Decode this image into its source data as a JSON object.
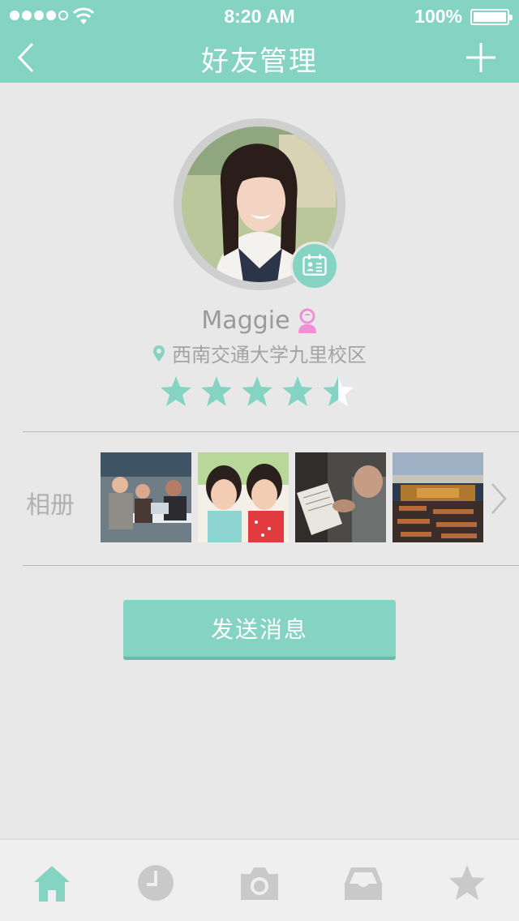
{
  "status_bar": {
    "time": "8:20 AM",
    "battery": "100%"
  },
  "nav": {
    "title": "好友管理"
  },
  "profile": {
    "name": "Maggie",
    "location": "西南交通大学九里校区",
    "rating": 4.5
  },
  "album": {
    "label": "相册"
  },
  "actions": {
    "send_label": "发送消息"
  },
  "tabs": [
    {
      "icon": "home-icon",
      "active": true
    },
    {
      "icon": "clock-icon",
      "active": false
    },
    {
      "icon": "camera-icon",
      "active": false
    },
    {
      "icon": "inbox-icon",
      "active": false
    },
    {
      "icon": "star-icon",
      "active": false
    }
  ],
  "colors": {
    "accent": "#84d3c3",
    "background": "#e8e8e8",
    "text": "#9a9a9a",
    "tab_inactive": "#c9c9c9",
    "female": "#f08fd8"
  }
}
